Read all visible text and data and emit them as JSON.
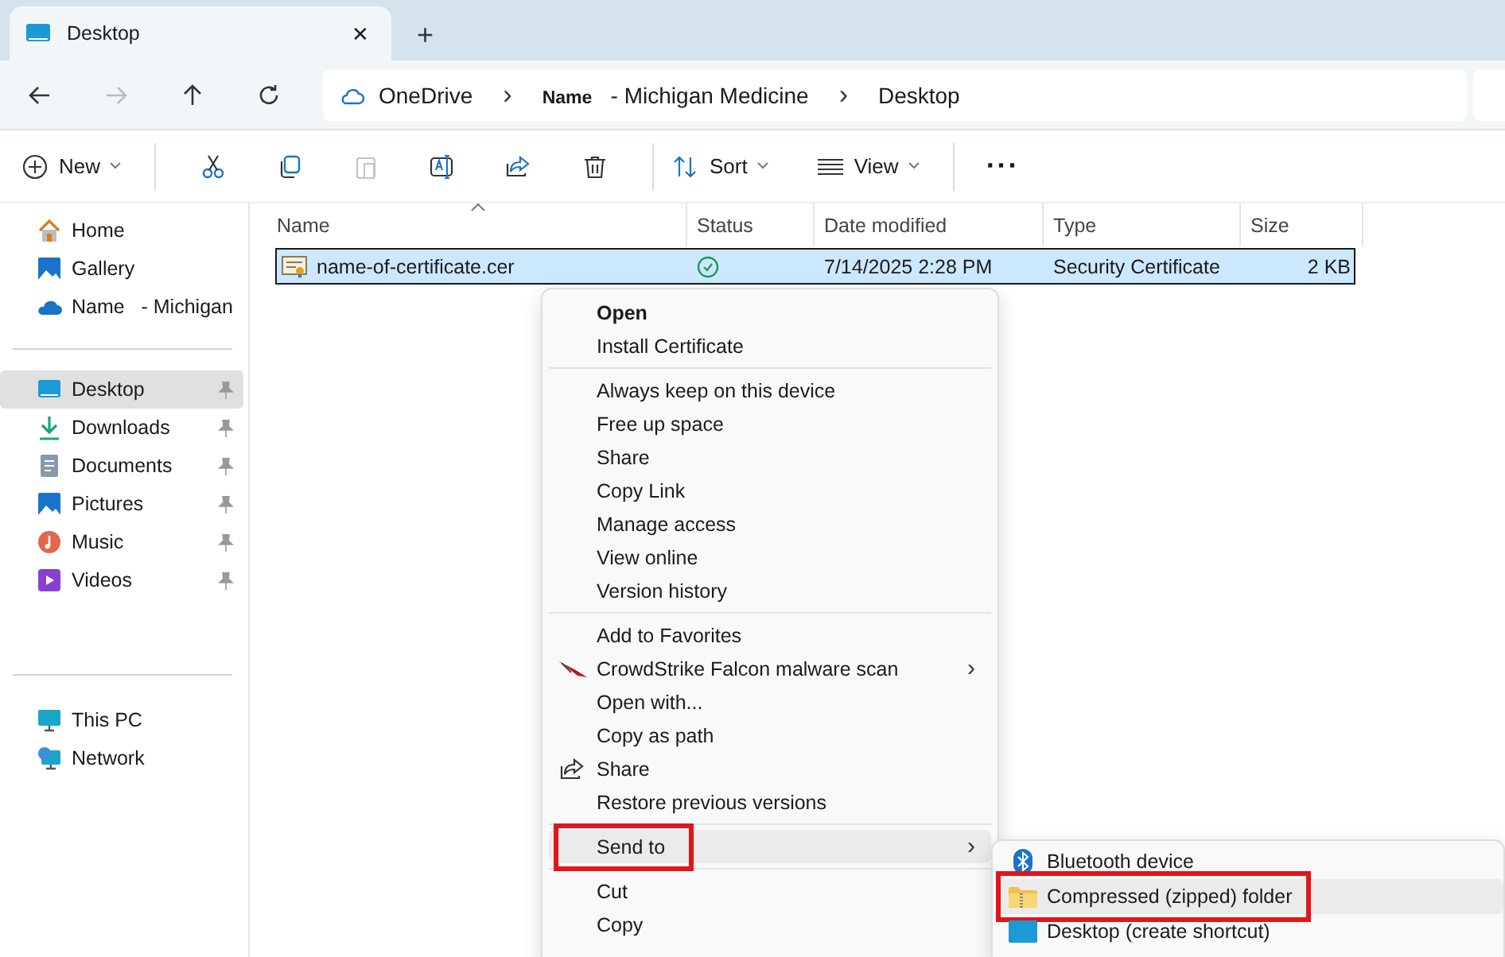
{
  "tab": {
    "title": "Desktop",
    "close": "✕",
    "new_tab": "+"
  },
  "nav": {
    "back_disabled": false,
    "forward_disabled": true,
    "crumbs": [
      "OneDrive",
      "**Name**   - Michigan Medicine",
      "Desktop"
    ],
    "separator": "›"
  },
  "toolbar": {
    "new_label": "New",
    "sort_label": "Sort",
    "view_label": "View",
    "more": "···",
    "paste_disabled": true
  },
  "sidebar": {
    "groups": [
      {
        "items": [
          {
            "label": "Home",
            "pinned": false,
            "selected": false
          },
          {
            "label": "Gallery",
            "pinned": false,
            "selected": false
          },
          {
            "label": "Name   - Michigan",
            "pinned": false,
            "selected": false
          }
        ]
      },
      {
        "items": [
          {
            "label": "Desktop",
            "pinned": true,
            "selected": true
          },
          {
            "label": "Downloads",
            "pinned": true,
            "selected": false
          },
          {
            "label": "Documents",
            "pinned": true,
            "selected": false
          },
          {
            "label": "Pictures",
            "pinned": true,
            "selected": false
          },
          {
            "label": "Music",
            "pinned": true,
            "selected": false
          },
          {
            "label": "Videos",
            "pinned": true,
            "selected": false
          }
        ]
      },
      {
        "items": [
          {
            "label": "This PC",
            "pinned": false,
            "selected": false
          },
          {
            "label": "Network",
            "pinned": false,
            "selected": false
          }
        ]
      }
    ]
  },
  "table": {
    "columns": [
      "Name",
      "Status",
      "Date modified",
      "Type",
      "Size"
    ],
    "rows": [
      {
        "name": "name-of-certificate.cer",
        "date": "7/14/2025 2:28 PM",
        "type": "Security Certificate",
        "size": "2 KB",
        "selected": true
      }
    ]
  },
  "context_menu": {
    "sections": [
      [
        {
          "label": "Open",
          "bold": true
        },
        {
          "label": "Install Certificate"
        }
      ],
      [
        {
          "label": "Always keep on this device"
        },
        {
          "label": "Free up space"
        },
        {
          "label": "Share"
        },
        {
          "label": "Copy Link"
        },
        {
          "label": "Manage access"
        },
        {
          "label": "View online"
        },
        {
          "label": "Version history"
        }
      ],
      [
        {
          "label": "Add to Favorites"
        },
        {
          "label": "CrowdStrike Falcon malware scan",
          "submenu": true,
          "submenu_mark": "›"
        },
        {
          "label": "Open with..."
        },
        {
          "label": "Copy as path"
        },
        {
          "label": "Share"
        },
        {
          "label": "Restore previous versions"
        }
      ],
      [
        {
          "label": "Send to",
          "submenu": true,
          "submenu_mark": "›",
          "hovered": true,
          "outlined": true
        }
      ],
      [
        {
          "label": "Cut"
        },
        {
          "label": "Copy"
        }
      ]
    ]
  },
  "submenu": {
    "items": [
      {
        "label": "Bluetooth device",
        "hovered": false,
        "outlined": false
      },
      {
        "label": "Compressed (zipped) folder",
        "hovered": true,
        "outlined": true
      },
      {
        "label": "Desktop (create shortcut)",
        "hovered": false,
        "outlined": false
      }
    ]
  }
}
